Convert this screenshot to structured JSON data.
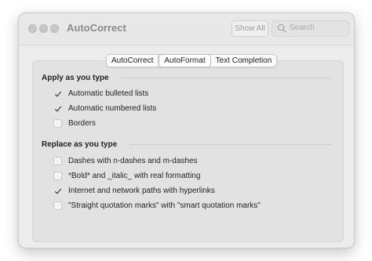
{
  "window": {
    "title": "AutoCorrect",
    "show_all_label": "Show All",
    "search_placeholder": "Search"
  },
  "tabs": [
    {
      "label": "AutoCorrect",
      "selected": false
    },
    {
      "label": "AutoFormat",
      "selected": true
    },
    {
      "label": "Text Completion",
      "selected": false
    }
  ],
  "apply_section": {
    "title": "Apply as you type",
    "options": [
      {
        "label": "Automatic bulleted lists",
        "checked": true
      },
      {
        "label": "Automatic numbered lists",
        "checked": true
      },
      {
        "label": "Borders",
        "checked": false
      }
    ]
  },
  "replace_section": {
    "title": "Replace as you type",
    "options": [
      {
        "label": "Dashes with n-dashes and m-dashes",
        "checked": false
      },
      {
        "label": "*Bold* and _italic_ with real formatting",
        "checked": false
      },
      {
        "label": "Internet and network paths with hyperlinks",
        "checked": true
      },
      {
        "label": "\"Straight quotation marks\" with \"smart quotation marks\"",
        "checked": false
      }
    ]
  },
  "colors": {
    "window_bg": "#ececec",
    "panel_bg": "#e2e2e2",
    "text": "#222222",
    "disabled_text": "#8a8a8a"
  }
}
